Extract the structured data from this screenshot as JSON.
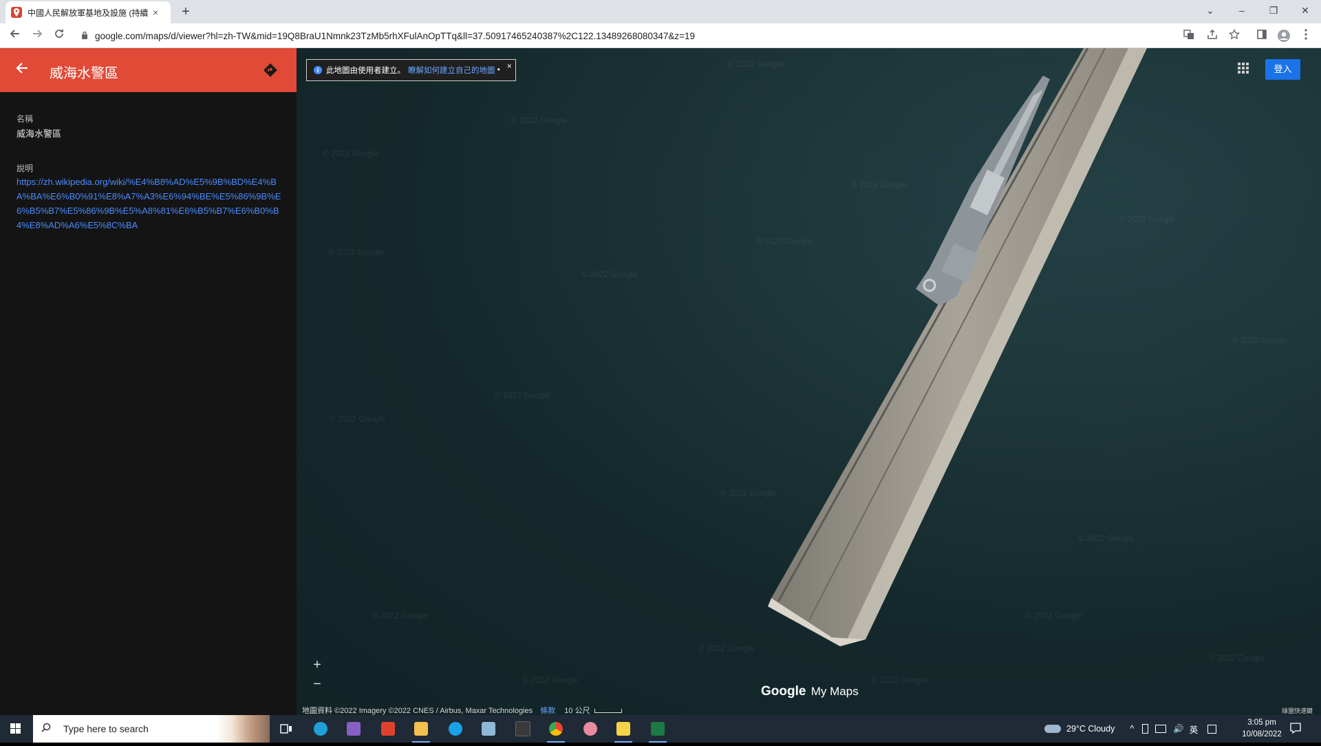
{
  "browser": {
    "tab_title": "中國人民解放軍基地及設施 (持續",
    "tab_close": "×",
    "new_tab": "+",
    "url": "google.com/maps/d/viewer?hl=zh-TW&mid=19Q8BraU1Nmnk23TzMb5rhXFulAnOpTTq&ll=37.50917465240387%2C122.13489268080347&z=19",
    "controls": {
      "minimize": "–",
      "maximize": "❐",
      "close": "✕",
      "dropdown": "⌄"
    }
  },
  "panel": {
    "title": "威海水警區",
    "name_label": "名稱",
    "name_value": "威海水警區",
    "desc_label": "說明",
    "desc_link": "https://zh.wikipedia.org/wiki/%E4%B8%AD%E5%9B%BD%E4%BA%BA%E6%B0%91%E8%A7%A3%E6%94%BE%E5%86%9B%E6%B5%B7%E5%86%9B%E5%A8%81%E6%B5%B7%E6%B0%B4%E8%AD%A6%E5%8C%BA"
  },
  "map": {
    "info_text": "此地圖由使用者建立。",
    "info_link": "瞭解如何建立自己的地圖",
    "info_close": "×",
    "sign_in": "登入",
    "zoom_in": "+",
    "zoom_out": "−",
    "brand_google": "Google",
    "brand_product": "My Maps",
    "attribution": "地圖資料 ©2022 Imagery ©2022 CNES / Airbus, Maxar Technologies",
    "terms": "條款",
    "scale": "10 公尺",
    "watermark": "© 2022 Google",
    "corner_mark": "綠盟快速鍵"
  },
  "taskbar": {
    "search_placeholder": "Type here to search",
    "weather": "29°C  Cloudy",
    "ime": "英",
    "time": "3:05 pm",
    "date": "10/08/2022"
  },
  "colors": {
    "header": "#e04a37",
    "panel_bg": "#141414",
    "link": "#4a8cff",
    "signin": "#1a73e8",
    "taskbar": "#1f2a36"
  }
}
